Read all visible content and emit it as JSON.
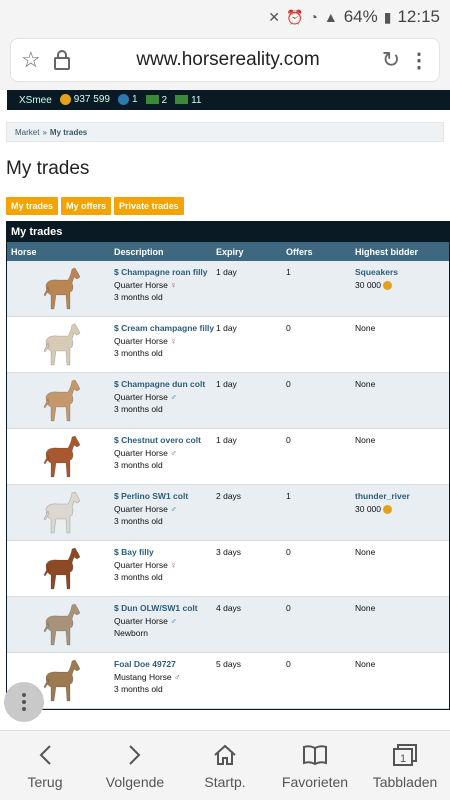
{
  "status": {
    "battery": "64%",
    "time": "12:15"
  },
  "browser": {
    "url": "www.horsereality.com"
  },
  "topnav": {
    "user": "XSmee",
    "coins": "937 599",
    "b": "1",
    "cash1": "2",
    "cash2": "11"
  },
  "breadcrumb": {
    "market": "Market",
    "sep": "»",
    "current": "My trades"
  },
  "page_title": "My trades",
  "tabs": [
    "My trades",
    "My offers",
    "Private trades"
  ],
  "table": {
    "title": "My trades",
    "headers": [
      "Horse",
      "Description",
      "Expiry",
      "Offers",
      "Highest bidder"
    ],
    "rows": [
      {
        "name": "$ Champagne roan filly",
        "breed": "Quarter Horse",
        "sex": "♀",
        "age": "3 months old",
        "expiry": "1 day",
        "offers": "1",
        "bidder": "Squeakers",
        "bid": "30 000",
        "color": "#b98552"
      },
      {
        "name": "$ Cream champagne filly",
        "breed": "Quarter Horse",
        "sex": "♀",
        "age": "3 months old",
        "expiry": "1 day",
        "offers": "0",
        "bidder": "None",
        "bid": "",
        "color": "#d8cbb6"
      },
      {
        "name": "$ Champagne dun colt",
        "breed": "Quarter Horse",
        "sex": "♂",
        "age": "3 months old",
        "expiry": "1 day",
        "offers": "0",
        "bidder": "None",
        "bid": "",
        "color": "#c4986a"
      },
      {
        "name": "$ Chestnut overo colt",
        "breed": "Quarter Horse",
        "sex": "♂",
        "age": "3 months old",
        "expiry": "1 day",
        "offers": "0",
        "bidder": "None",
        "bid": "",
        "color": "#a8582e"
      },
      {
        "name": "$ Perlino SW1 colt",
        "breed": "Quarter Horse",
        "sex": "♂",
        "age": "3 months old",
        "expiry": "2 days",
        "offers": "1",
        "bidder": "thunder_river",
        "bid": "30 000",
        "color": "#ddd8cf"
      },
      {
        "name": "$ Bay filly",
        "breed": "Quarter Horse",
        "sex": "♀",
        "age": "3 months old",
        "expiry": "3 days",
        "offers": "0",
        "bidder": "None",
        "bid": "",
        "color": "#8c4a24"
      },
      {
        "name": "$ Dun OLW/SW1 colt",
        "breed": "Quarter Horse",
        "sex": "♂",
        "age": "Newborn",
        "expiry": "4 days",
        "offers": "0",
        "bidder": "None",
        "bid": "",
        "color": "#a8937a"
      },
      {
        "name": "Foal Doe 49727",
        "breed": "Mustang Horse",
        "sex": "♂",
        "age": "3 months old",
        "expiry": "5 days",
        "offers": "0",
        "bidder": "None",
        "bid": "",
        "color": "#9c7a52"
      }
    ]
  },
  "bottom_nav": [
    "Terug",
    "Volgende",
    "Startp.",
    "Favorieten",
    "Tabbladen"
  ],
  "tab_count": "1"
}
